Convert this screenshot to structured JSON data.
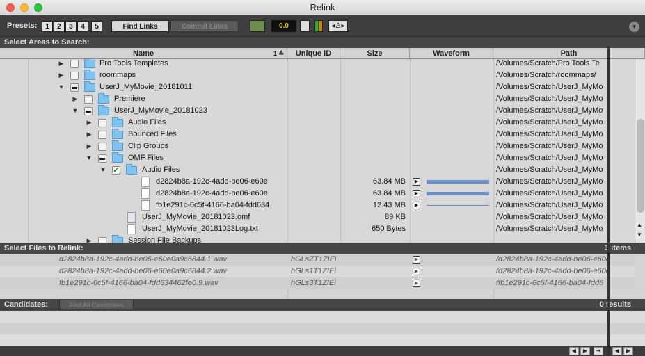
{
  "window": {
    "title": "Relink"
  },
  "toolbar": {
    "presets_label": "Presets:",
    "presets": [
      "1",
      "2",
      "3",
      "4",
      "5"
    ],
    "find_links": "Find Links",
    "commit_links": "Commit Links",
    "gain_value": "0.0"
  },
  "areas": {
    "label": "Select Areas to Search:",
    "columns": {
      "name": "Name",
      "sort": "1 ≙",
      "unique_id": "Unique ID",
      "size": "Size",
      "waveform": "Waveform",
      "path": "Path"
    },
    "rows": [
      {
        "name": "Pro Tools Templates",
        "path": "/Volumes/Scratch/Pro Tools Te"
      },
      {
        "name": "roommaps",
        "path": "/Volumes/Scratch/roommaps/"
      },
      {
        "name": "UserJ_MyMovie_20181011",
        "path": "/Volumes/Scratch/UserJ_MyMo"
      },
      {
        "name": "Premiere",
        "path": "/Volumes/Scratch/UserJ_MyMo"
      },
      {
        "name": "UserJ_MyMovie_20181023",
        "path": "/Volumes/Scratch/UserJ_MyMo"
      },
      {
        "name": "Audio Files",
        "path": "/Volumes/Scratch/UserJ_MyMo"
      },
      {
        "name": "Bounced Files",
        "path": "/Volumes/Scratch/UserJ_MyMo"
      },
      {
        "name": "Clip Groups",
        "path": "/Volumes/Scratch/UserJ_MyMo"
      },
      {
        "name": "OMF Files",
        "path": "/Volumes/Scratch/UserJ_MyMo"
      },
      {
        "name": "Audio Files",
        "path": "/Volumes/Scratch/UserJ_MyMo"
      },
      {
        "name": "d2824b8a-192c-4add-be06-e60e",
        "size": "63.84 MB",
        "path": "/Volumes/Scratch/UserJ_MyMo"
      },
      {
        "name": "d2824b8a-192c-4add-be06-e60e",
        "size": "63.84 MB",
        "path": "/Volumes/Scratch/UserJ_MyMo"
      },
      {
        "name": "fb1e291c-6c5f-4166-ba04-fdd634",
        "size": "12.43 MB",
        "path": "/Volumes/Scratch/UserJ_MyMo"
      },
      {
        "name": "UserJ_MyMovie_20181023.omf",
        "size": "89 KB",
        "path": "/Volumes/Scratch/UserJ_MyMo"
      },
      {
        "name": "UserJ_MyMovie_20181023Log.txt",
        "size": "650 Bytes",
        "path": "/Volumes/Scratch/UserJ_MyMo"
      },
      {
        "name": "Session File Backups",
        "path": ""
      }
    ]
  },
  "relink": {
    "label": "Select Files to Relink:",
    "count": "3 items",
    "rows": [
      {
        "name": "d2824b8a-192c-4add-be06-e60e0a9c6844.1.wav",
        "uid": "hGLsZT1ZIEi",
        "path": "/d2824b8a-192c-4add-be06-e60e"
      },
      {
        "name": "d2824b8a-192c-4add-be06-e60e0a9c6844.2.wav",
        "uid": "hGLs1T1ZIEi",
        "path": "/d2824b8a-192c-4add-be06-e60e"
      },
      {
        "name": "fb1e291c-6c5f-4166-ba04-fdd634462fe0.9.wav",
        "uid": "hGLs3T1ZIEi",
        "path": "/fb1e291c-6c5f-4166-ba04-fdd6"
      }
    ]
  },
  "candidates": {
    "label": "Candidates:",
    "find_all": "Find All Candidates",
    "results": "0 results"
  }
}
